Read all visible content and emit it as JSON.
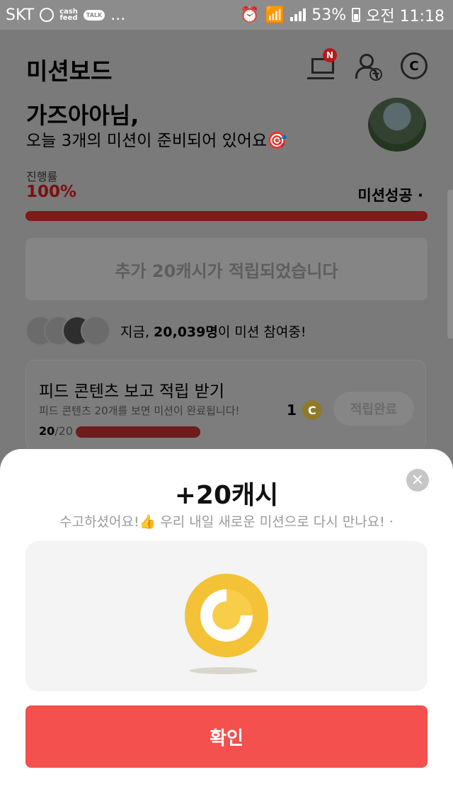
{
  "status_bar": {
    "carrier": "SKT",
    "app1": "cash\nfeed",
    "app2": "TALK",
    "more": "...",
    "battery": "53%",
    "time": "오전 11:18"
  },
  "header": {
    "title": "미션보드",
    "cart_badge": "N",
    "coin_glyph": "C"
  },
  "greeting": {
    "name": "가즈아아님,",
    "message": "오늘 3개의 미션이 준비되어 있어요🎯"
  },
  "progress": {
    "label": "진행률",
    "value": "100%",
    "fraction": 1.0,
    "status": "미션성공 ·"
  },
  "bonus_banner": "추가 20캐시가 적립되었습니다",
  "participants": {
    "prefix": "지금, ",
    "count": "20,039명",
    "suffix": "이 미션 참여중!"
  },
  "mission_card": {
    "title": "피드 콘텐츠 보고 적립 받기",
    "description": "피드 콘텐츠 20개를 보면 미션이 완료됩니다!",
    "count_done": "20",
    "count_total": "/20",
    "progress_fraction": 1.0,
    "reward": "1",
    "coin_glyph": "C",
    "button": "적립완료"
  },
  "sheet": {
    "close": "✕",
    "title": "+20캐시",
    "subtitle": "수고하셨어요!👍 우리 내일 새로운 미션으로 다시 만나요! ·",
    "confirm": "확인"
  },
  "colors": {
    "accent": "#f4504d",
    "coin": "#f4c236",
    "progress": "#7d1a1a"
  }
}
